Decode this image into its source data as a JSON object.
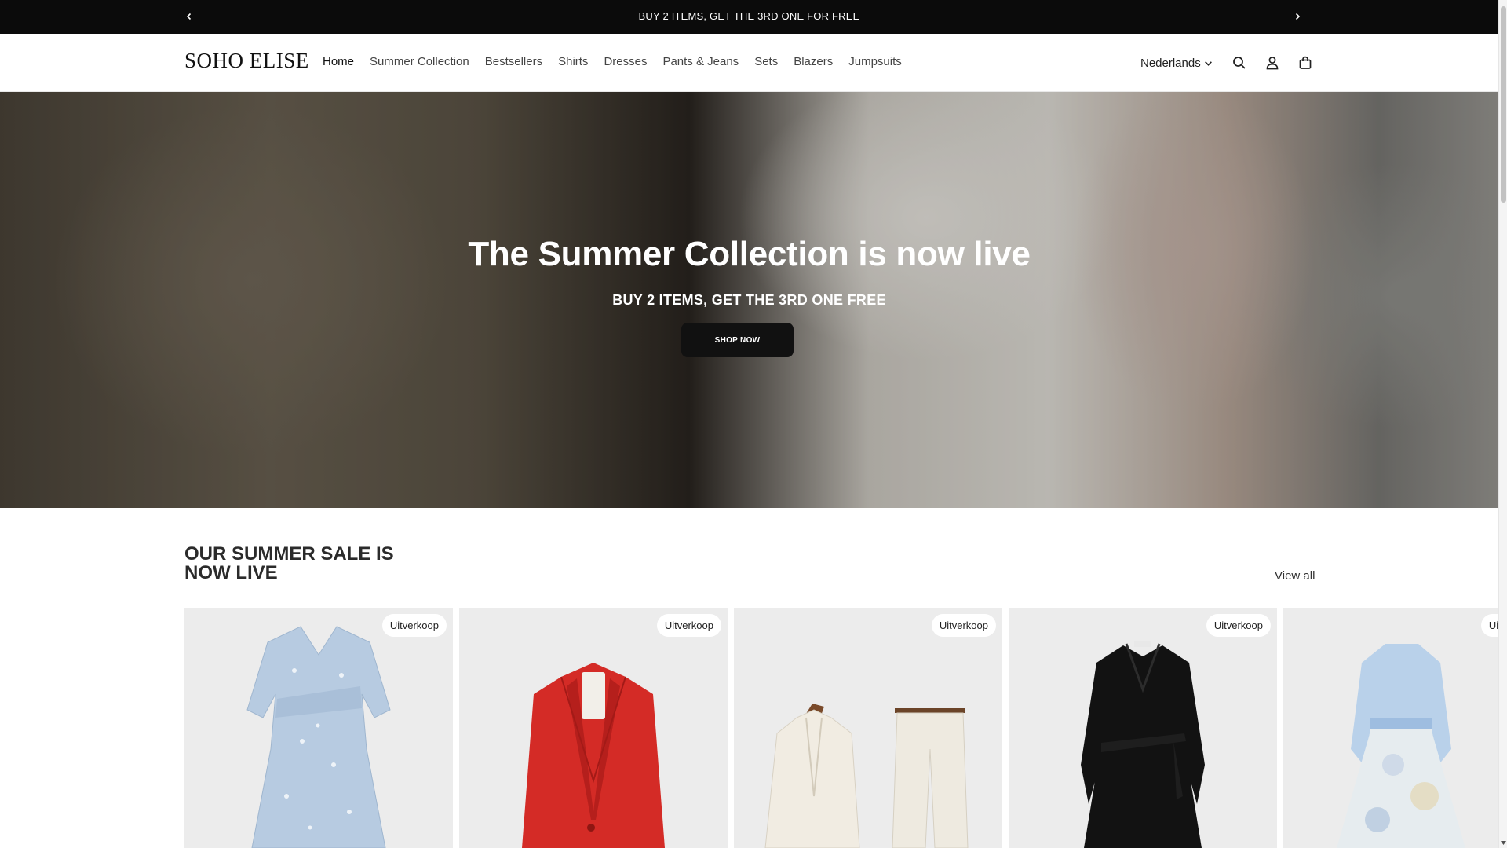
{
  "announcement": {
    "text": "BUY 2 ITEMS, GET THE 3RD ONE FOR FREE",
    "prev_icon": "chevron-left-icon",
    "next_icon": "chevron-right-icon"
  },
  "header": {
    "logo": "SOHO ELISE",
    "nav": [
      {
        "label": "Home"
      },
      {
        "label": "Summer Collection"
      },
      {
        "label": "Bestsellers"
      },
      {
        "label": "Shirts"
      },
      {
        "label": "Dresses"
      },
      {
        "label": "Pants & Jeans"
      },
      {
        "label": "Sets"
      },
      {
        "label": "Blazers"
      },
      {
        "label": "Jumpsuits"
      }
    ],
    "language": "Nederlands",
    "icons": [
      "search-icon",
      "account-icon",
      "cart-icon"
    ]
  },
  "hero": {
    "title": "The Summer Collection is now live",
    "subtitle": "BUY 2 ITEMS, GET THE 3RD ONE FREE",
    "button": "SHOP NOW"
  },
  "sale": {
    "heading": "OUR SUMMER SALE IS NOW LIVE",
    "view_all": "View all",
    "products": [
      {
        "badge": "Uitverkoop",
        "item": "light-blue floral dress"
      },
      {
        "badge": "Uitverkoop",
        "item": "red blazer"
      },
      {
        "badge": "Uitverkoop",
        "item": "cream blazer and trousers set"
      },
      {
        "badge": "Uitverkoop",
        "item": "black wrap dress"
      },
      {
        "badge": "Uitverkoop",
        "item": "light-blue chiffon dress"
      }
    ]
  },
  "colors": {
    "announcement_bg": "#0b0b0b",
    "button_bg": "#111111",
    "card_bg": "#ececec"
  }
}
